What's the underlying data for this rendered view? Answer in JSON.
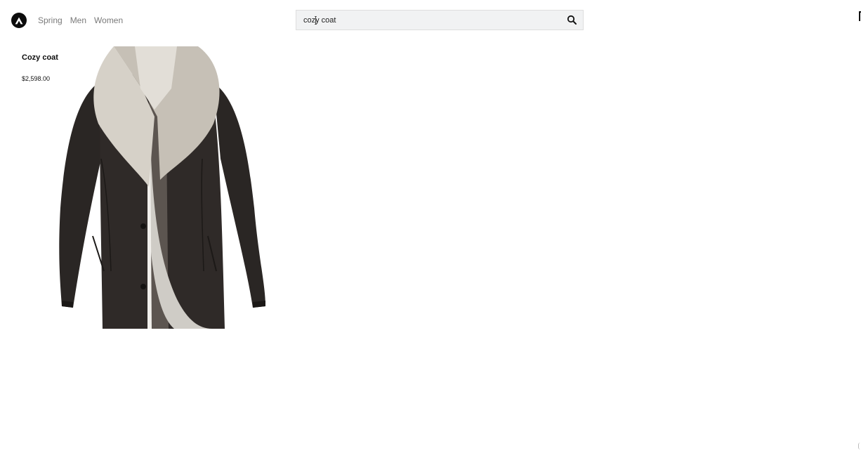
{
  "header": {
    "logo": "triangle-logo",
    "nav": [
      "Spring",
      "Men",
      "Women"
    ],
    "search": {
      "value": "cozy coat",
      "icon": "search-icon"
    },
    "cart_icon": "cart-icon"
  },
  "results": [
    {
      "title": "Cozy coat",
      "price": "$2,598.00"
    }
  ],
  "colors": {
    "logo_bg": "#0c0c0c",
    "nav_text": "#7a7a7a",
    "search_bg": "#f1f2f3"
  }
}
